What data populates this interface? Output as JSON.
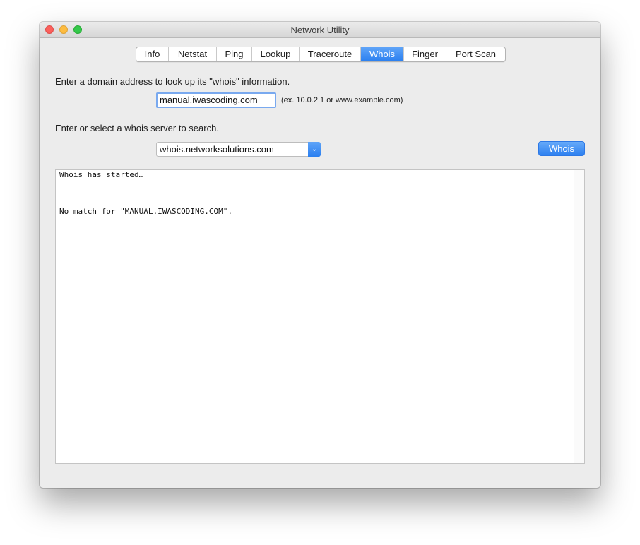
{
  "window": {
    "title": "Network Utility"
  },
  "tabs": [
    {
      "label": "Info",
      "active": false
    },
    {
      "label": "Netstat",
      "active": false
    },
    {
      "label": "Ping",
      "active": false
    },
    {
      "label": "Lookup",
      "active": false
    },
    {
      "label": "Traceroute",
      "active": false
    },
    {
      "label": "Whois",
      "active": true
    },
    {
      "label": "Finger",
      "active": false
    },
    {
      "label": "Port Scan",
      "active": false
    }
  ],
  "whois": {
    "domain_prompt": "Enter a domain address to look up its \"whois\" information.",
    "domain_value": "manual.iwascoding.com",
    "domain_hint": "(ex. 10.0.2.1 or www.example.com)",
    "server_prompt": "Enter or select a whois server to search.",
    "server_value": "whois.networksolutions.com",
    "button_label": "Whois",
    "output_line_1": "Whois has started…",
    "output_line_2": "No match for \"MANUAL.IWASCODING.COM\"."
  },
  "colors": {
    "accent": "#2a7ff0",
    "close": "#fc605c",
    "minimize": "#fdbc40",
    "maximize": "#34c84a"
  }
}
